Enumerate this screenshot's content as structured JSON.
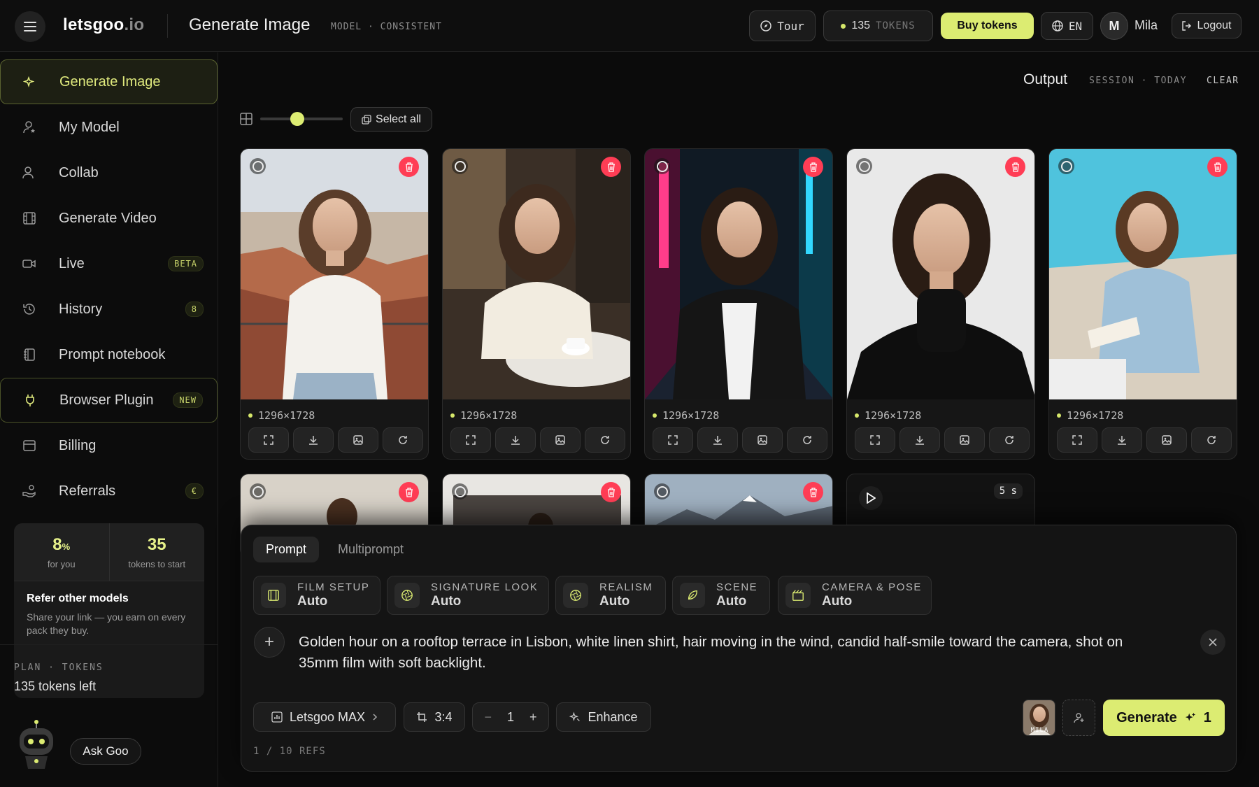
{
  "app": {
    "logo_main": "letsgoo",
    "logo_ext": ".io",
    "page_title": "Generate Image",
    "page_subtitle": "MODEL · CONSISTENT"
  },
  "topbar": {
    "tour_label": "Tour",
    "tokens_count": "135",
    "tokens_label": "TOKENS",
    "buy_label": "Buy tokens",
    "lang_label": "EN",
    "avatar_initial": "M",
    "user_name": "Mila",
    "logout_label": "Logout"
  },
  "sidebar": {
    "items": [
      {
        "label": "Generate Image",
        "icon": "sparkle-icon",
        "active": true
      },
      {
        "label": "My Model",
        "icon": "user-star-icon"
      },
      {
        "label": "Collab",
        "icon": "users-icon"
      },
      {
        "label": "Generate Video",
        "icon": "film-icon"
      },
      {
        "label": "Live",
        "icon": "video-camera-icon",
        "badge": "BETA"
      },
      {
        "label": "History",
        "icon": "history-icon",
        "badge": "8"
      },
      {
        "label": "Prompt notebook",
        "icon": "notebook-icon"
      },
      {
        "label": "Browser Plugin",
        "icon": "plug-icon",
        "badge": "NEW"
      },
      {
        "label": "Billing",
        "icon": "card-icon"
      },
      {
        "label": "Referrals",
        "icon": "hand-coins-icon",
        "badge": "€"
      }
    ],
    "referral": {
      "pct": "8",
      "pct_unit": "%",
      "pct_label": "for you",
      "tokens": "35",
      "tokens_label": "tokens to start",
      "title": "Refer other models",
      "desc": "Share your link — you earn on every pack they buy."
    },
    "plan_label": "PLAN · TOKENS",
    "plan_value": "135 tokens left",
    "ask_label": "Ask Goo"
  },
  "output": {
    "title": "Output",
    "subtitle": "SESSION · TODAY",
    "clear_label": "CLEAR",
    "select_all_label": "Select all",
    "zoom_level": 0.45,
    "images": [
      {
        "dims": "1296×1728",
        "scene": "rooftop"
      },
      {
        "dims": "1296×1728",
        "scene": "cafe"
      },
      {
        "dims": "1296×1728",
        "scene": "neon"
      },
      {
        "dims": "1296×1728",
        "scene": "studio"
      },
      {
        "dims": "1296×1728",
        "scene": "pool"
      }
    ],
    "video_duration": "5 s"
  },
  "prompt_panel": {
    "tabs": [
      "Prompt",
      "Multiprompt"
    ],
    "chips": [
      {
        "label": "FILM SETUP",
        "value": "Auto",
        "icon": "film-icon"
      },
      {
        "label": "SIGNATURE LOOK",
        "value": "Auto",
        "icon": "aperture-icon"
      },
      {
        "label": "REALISM",
        "value": "Auto",
        "icon": "aperture-icon"
      },
      {
        "label": "SCENE",
        "value": "Auto",
        "icon": "leaf-icon"
      },
      {
        "label": "CAMERA & POSE",
        "value": "Auto",
        "icon": "clapper-icon"
      }
    ],
    "prompt_text": "Golden hour on a rooftop terrace in Lisbon, white linen shirt, hair moving in the wind, candid half-smile toward the camera, shot on 35mm film with soft backlight.",
    "model_label": "Letsgoo MAX",
    "ratio_label": "3:4",
    "count_value": "1",
    "enhance_label": "Enhance",
    "refs_label": "1 / 10 REFS",
    "ref_thumb_label": "MILA",
    "generate_label": "Generate",
    "generate_cost": "1"
  },
  "colors": {
    "accent": "#dcec72",
    "delete": "#ff3d55",
    "background": "#0b0b0b"
  }
}
